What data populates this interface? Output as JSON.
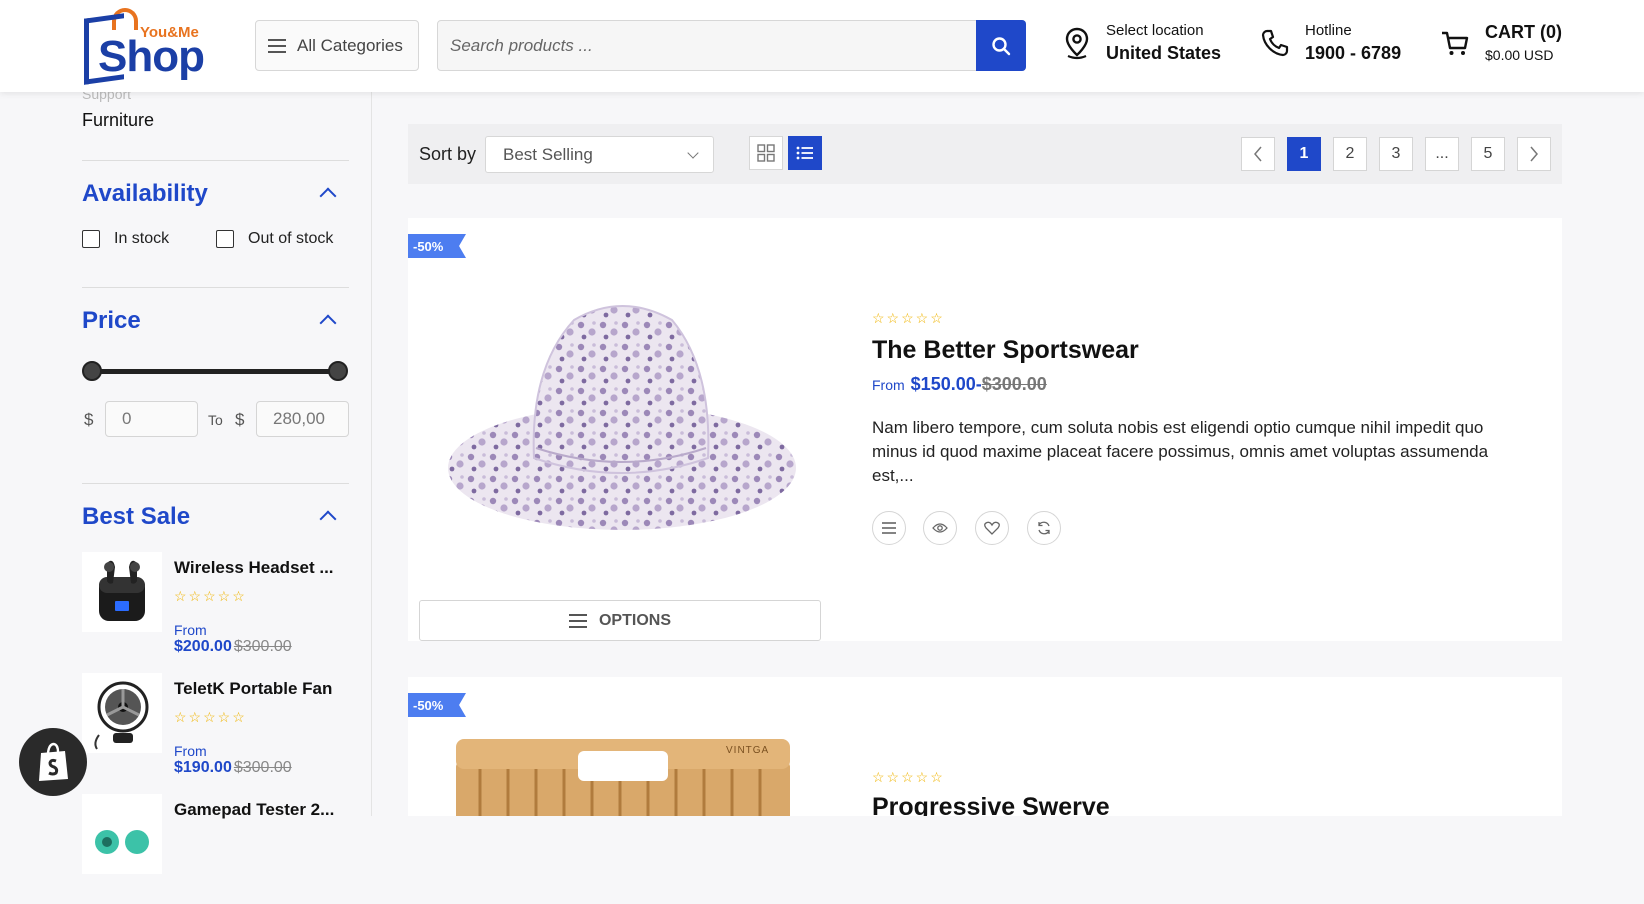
{
  "header": {
    "logo_small": "You&Me",
    "logo_big": "Shop",
    "categories_label": "All Categories",
    "search_placeholder": "Search products ...",
    "location_title": "Select location",
    "location_value": "United States",
    "hotline_title": "Hotline",
    "hotline_value": "1900 - 6789",
    "cart_title": "CART (0)",
    "cart_value": "$0.00 USD"
  },
  "sidebar": {
    "ghost_text": "Support",
    "top_item": "Furniture",
    "availability": {
      "title": "Availability",
      "options": [
        "In stock",
        "Out of stock"
      ]
    },
    "price": {
      "title": "Price",
      "currency": "$",
      "to_label": "To",
      "min": "0",
      "max": "280,00",
      "range_low": 0,
      "range_high": 1
    },
    "best_sale": {
      "title": "Best Sale",
      "items": [
        {
          "name": "Wireless Headset ...",
          "from": "From",
          "price": "$200.00",
          "old": "$300.00"
        },
        {
          "name": "TeletK Portable Fan",
          "from": "From",
          "price": "$190.00",
          "old": "$300.00"
        },
        {
          "name": "Gamepad Tester 2..."
        }
      ]
    }
  },
  "toolbar": {
    "sort_label": "Sort by",
    "sort_value": "Best Selling",
    "pages": [
      "1",
      "2",
      "3",
      "...",
      "5"
    ],
    "active_page": "1"
  },
  "products": [
    {
      "badge": "-50%",
      "name": "The Better Sportswear",
      "from": "From",
      "price": "$150.00",
      "dash": "-",
      "old": "$300.00",
      "description": "Nam libero tempore, cum soluta nobis est eligendi optio cumque nihil impedit quo minus id quod maxime placeat facere possimus, omnis amet voluptas assumenda est,...",
      "options_label": "OPTIONS"
    },
    {
      "badge": "-50%",
      "name": "Progressive Swerve",
      "image_brand": "VINTGA"
    }
  ],
  "stars_glyph": "☆☆☆☆☆",
  "colors": {
    "brand_blue": "#1f48c9",
    "ribbon_blue": "#4d7df0",
    "star": "#f0b400",
    "logo_orange": "#e8731f"
  }
}
